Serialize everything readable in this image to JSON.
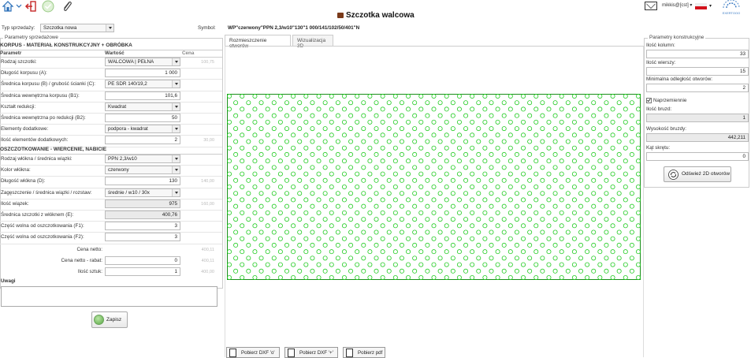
{
  "toolbar": {
    "icons": [
      "home-icon",
      "logout-icon",
      "ok-icon",
      "attachment-icon"
    ]
  },
  "header": {
    "title": "Szczotka walcowa",
    "user": "mikkis@[cst]",
    "logo_text": "EXERTOOO"
  },
  "sale_type": {
    "label": "Typ sprzedaży:",
    "value": "Szczotka nowa"
  },
  "symbol": {
    "label": "Symbol:",
    "value": "WP\"czerwony\"PPN 2,3/w10\"130\"1 000/141/102/50/401\"N"
  },
  "sales_params": {
    "legend": "Parametry sprzedażowe",
    "section1": "KORPUS - MATERIAŁ KONSTRUKCYJNY + OBRÓBKA",
    "columns": {
      "param": "Parametr",
      "value": "Wartość",
      "price": "Cena"
    },
    "rows1": [
      {
        "label": "Rodzaj szczotki:",
        "type": "select",
        "value": "WALCOWA | PEŁNA",
        "price": "100,75"
      },
      {
        "label": "Długość korpusu (A):",
        "type": "input",
        "value": "1 000",
        "price": ""
      },
      {
        "label": "Średnica korpusu (B) / grubość ścianki (C):",
        "type": "select",
        "value": "PE SDR 140/19,2",
        "price": ""
      },
      {
        "label": "Średnica wewnętrzna korpusu (B1):",
        "type": "input",
        "value": "101,6",
        "price": ""
      },
      {
        "label": "Kształt redukcji:",
        "type": "select",
        "value": "Kwadrat",
        "price": ""
      },
      {
        "label": "Średnica wewnętrzna po redukcji (B2):",
        "type": "input",
        "value": "50",
        "price": ""
      },
      {
        "label": "Elementy dodatkowe:",
        "type": "select",
        "value": "podpora - kwadrat",
        "price": ""
      },
      {
        "label": "Ilość elementów dodatkowych:",
        "type": "input",
        "value": "2",
        "price": "30,00"
      }
    ],
    "section2": "OSZCZOTKOWANIE - WIERCENIE, NABICIE",
    "rows2": [
      {
        "label": "Rodzaj włókna / średnica wiązki:",
        "type": "select",
        "value": "PPN 2,3/w10",
        "price": ""
      },
      {
        "label": "Kolor włókna:",
        "type": "select",
        "value": "czerwony",
        "price": ""
      },
      {
        "label": "Długość włókna (D):",
        "type": "input",
        "value": "130",
        "price": "140,00"
      },
      {
        "label": "Zagęszczenie / średnica wiązki / rozstaw:",
        "type": "select",
        "value": "średnie / w10 / 30x",
        "price": ""
      },
      {
        "label": "Ilość wiązek:",
        "type": "input",
        "value": "975",
        "price": "160,00",
        "gray": true
      },
      {
        "label": "Średnica szczotki z włóknem (E):",
        "type": "input",
        "value": "400,76",
        "price": "",
        "gray": true
      },
      {
        "label": "Część wolna od oszczotkowania (F1):",
        "type": "input",
        "value": "3",
        "price": ""
      },
      {
        "label": "Część wolna od oszczotkowania (F2):",
        "type": "input",
        "value": "3",
        "price": ""
      }
    ],
    "totals": [
      {
        "label": "Cena netto:",
        "value": "",
        "price": "400,11"
      },
      {
        "label": "Cena netto - rabat:",
        "value": "0",
        "price": "400,11"
      },
      {
        "label": "Ilość sztuk:",
        "value": "1",
        "price": "400,00"
      }
    ]
  },
  "notes": {
    "label": "Uwagi",
    "value": ""
  },
  "save_button": "Zapisz",
  "tabs": [
    {
      "label": "Rozmieszczenie otworów",
      "active": true
    },
    {
      "label": "Wizualizacja 3D",
      "active": false
    }
  ],
  "holes_grid": {
    "columns": 33,
    "rows": 15,
    "color": "#22cc22"
  },
  "downloads": [
    {
      "label": "Pobierz DXF 'o'"
    },
    {
      "label": "Pobierz DXF '+'"
    },
    {
      "label": "Pobierz pdf"
    }
  ],
  "construction": {
    "legend": "Parametry konstrukcyjne",
    "fields": [
      {
        "label": "Ilość kolumn:",
        "value": "33",
        "gray": false
      },
      {
        "label": "Ilość wierszy:",
        "value": "15",
        "gray": false
      },
      {
        "label": "Minimalna odległość otworów:",
        "value": "2",
        "gray": false
      }
    ],
    "alternate_label": "Naprzemiennie",
    "alternate_checked": true,
    "fields2": [
      {
        "label": "Ilość bruzd:",
        "value": "1",
        "gray": true
      },
      {
        "label": "Wysokość bruzdy:",
        "value": "442,211",
        "gray": true
      },
      {
        "label": "Kąt skrętu:",
        "value": "0",
        "gray": false
      }
    ],
    "refresh_button": "Odśwież 2D otworów"
  },
  "colors": {
    "accent_green": "#22cc22",
    "frame_green": "#1a8f1a",
    "flag_red": "#d3121b"
  }
}
